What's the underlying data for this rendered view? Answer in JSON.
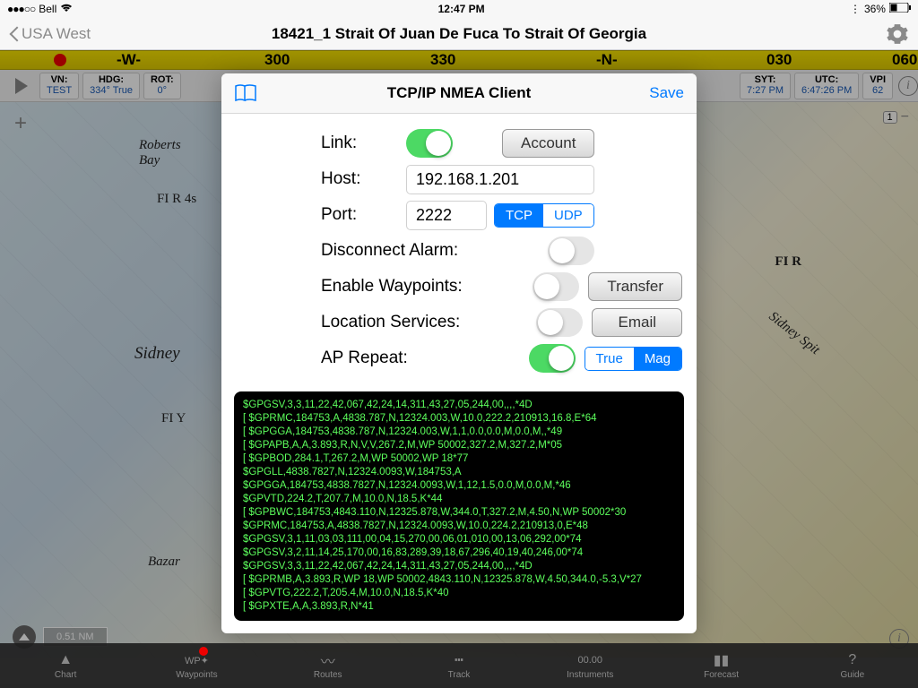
{
  "status": {
    "carrier": "Bell",
    "time": "12:47 PM",
    "battery": "36%",
    "bt": "᚛"
  },
  "nav": {
    "back": "USA West",
    "title": "18421_1 Strait Of Juan De Fuca To Strait Of Georgia"
  },
  "compass": {
    "w": "-W-",
    "d1": "300",
    "d2": "330",
    "n": "-N-",
    "d3": "030",
    "d4": "060"
  },
  "data": {
    "vn": {
      "label": "VN:",
      "value": "TEST"
    },
    "hdg": {
      "label": "HDG:",
      "value": "334° True"
    },
    "rot": {
      "label": "ROT:",
      "value": "0°"
    },
    "syt": {
      "label": "SYT:",
      "value": "7:27 PM"
    },
    "utc": {
      "label": "UTC:",
      "value": "6:47:26 PM"
    },
    "vp": {
      "label": "VPI",
      "value": "62"
    }
  },
  "scale": "0.51 NM",
  "zoom_ctl": "1",
  "modal": {
    "title": "TCP/IP NMEA Client",
    "save": "Save",
    "link": "Link:",
    "account": "Account",
    "host": "Host:",
    "host_value": "192.168.1.201",
    "port": "Port:",
    "port_value": "2222",
    "tcp": "TCP",
    "udp": "UDP",
    "disconnect": "Disconnect Alarm:",
    "waypoints": "Enable Waypoints:",
    "transfer": "Transfer",
    "location": "Location Services:",
    "email": "Email",
    "ap": "AP Repeat:",
    "true": "True",
    "mag": "Mag"
  },
  "nmea": [
    "$GPGSV,3,3,11,22,42,067,42,24,14,311,43,27,05,244,00,,,,*4D",
    "[ $GPRMC,184753,A,4838.787,N,12324.003,W,10.0,222.2,210913,16.8,E*64",
    "[ $GPGGA,184753,4838.787,N,12324.003,W,1,1,0.0,0.0,M,0.0,M,,*49",
    "[ $GPAPB,A,A,3.893,R,N,V,V,267.2,M,WP 50002,327.2,M,327.2,M*05",
    "[ $GPBOD,284.1,T,267.2,M,WP 50002,WP 18*77",
    "$GPGLL,4838.7827,N,12324.0093,W,184753,A",
    "$GPGGA,184753,4838.7827,N,12324.0093,W,1,12,1.5,0.0,M,0.0,M,*46",
    "$GPVTD,224.2,T,207.7,M,10.0,N,18.5,K*44",
    "[ $GPBWC,184753,4843.110,N,12325.878,W,344.0,T,327.2,M,4.50,N,WP 50002*30",
    "$GPRMC,184753,A,4838.7827,N,12324.0093,W,10.0,224.2,210913,0,E*48",
    "$GPGSV,3,1,11,03,03,111,00,04,15,270,00,06,01,010,00,13,06,292,00*74",
    "$GPGSV,3,2,11,14,25,170,00,16,83,289,39,18,67,296,40,19,40,246,00*74",
    "$GPGSV,3,3,11,22,42,067,42,24,14,311,43,27,05,244,00,,,,*4D",
    "[ $GPRMB,A,3.893,R,WP 18,WP 50002,4843.110,N,12325.878,W,4.50,344.0,-5.3,V*27",
    "[ $GPVTG,222.2,T,205.4,M,10.0,N,18.5,K*40",
    "[ $GPXTE,A,A,3.893,R,N*41"
  ],
  "tabs": {
    "chart": "Chart",
    "waypoints": "Waypoints",
    "routes": "Routes",
    "track": "Track",
    "instruments": "Instruments",
    "forecast": "Forecast",
    "guide": "Guide",
    "wp_icon": "WP✦",
    "inst_icon": "00.00"
  },
  "map_labels": {
    "sidney": "Sidney",
    "roberts": "Roberts\nBay",
    "bazar": "Bazar",
    "flr": "FI R",
    "flr4": "FI R 4s",
    "fly": "FI Y",
    "spit": "Sidney Spit"
  }
}
